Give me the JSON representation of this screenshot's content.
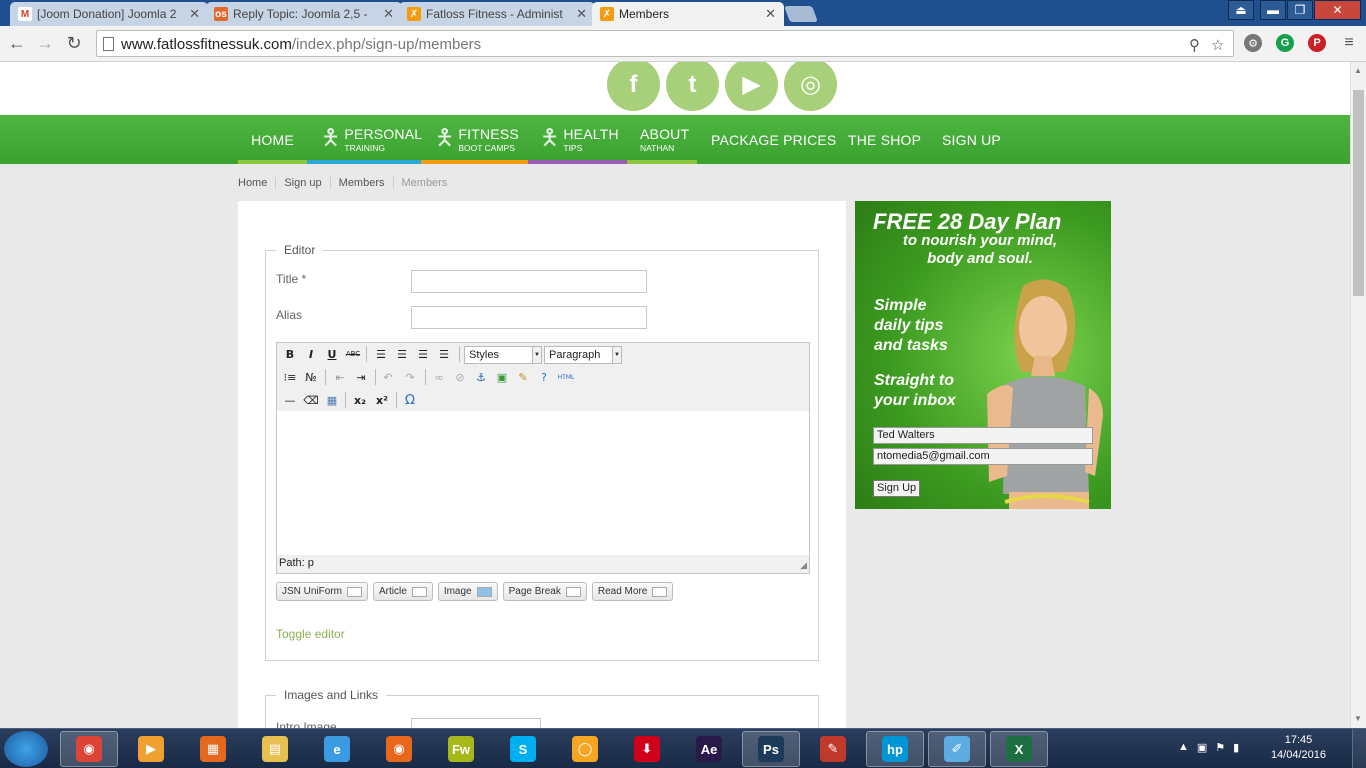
{
  "browser": {
    "tabs": [
      {
        "title": "[Joom Donation] Joomla 2",
        "fav": "M",
        "fav_color": "#d23f31"
      },
      {
        "title": "Reply Topic: Joomla 2,5 -",
        "fav": "os",
        "fav_color": "#e06a2c"
      },
      {
        "title": "Fatloss Fitness - Administ",
        "fav": "✗",
        "fav_color": "#f39c12"
      },
      {
        "title": "Members",
        "fav": "✗",
        "fav_color": "#f39c12"
      }
    ],
    "url_host": "www.fatlossfitnessuk.com",
    "url_path": "/index.php/sign-up/members",
    "window_controls": {
      "minimize": "▬",
      "maximize": "❐",
      "close": "✕"
    }
  },
  "site": {
    "social": [
      "f",
      "t",
      "▶",
      "◎"
    ],
    "nav": [
      {
        "label": "HOME",
        "sub": "",
        "color": "#8dc63f"
      },
      {
        "label": "PERSONAL",
        "sub": "TRAINING",
        "color": "#2aa8d8"
      },
      {
        "label": "FITNESS",
        "sub": "BOOT CAMPS",
        "color": "#f39c12"
      },
      {
        "label": "HEALTH",
        "sub": "TIPS",
        "color": "#9b59b6"
      },
      {
        "label": "ABOUT",
        "sub": "NATHAN",
        "color": "#8dc63f"
      },
      {
        "label": "PACKAGE PRICES",
        "sub": "",
        "color": ""
      },
      {
        "label": "THE SHOP",
        "sub": "",
        "color": ""
      },
      {
        "label": "SIGN UP",
        "sub": "",
        "color": ""
      }
    ],
    "breadcrumb": [
      "Home",
      "Sign up",
      "Members",
      "Members"
    ]
  },
  "form": {
    "editor_legend": "Editor",
    "title_label": "Title *",
    "title_value": "",
    "alias_label": "Alias",
    "alias_value": "",
    "styles_select": "Styles",
    "paragraph_select": "Paragraph",
    "path_text": "Path: p",
    "editor_buttons": [
      "JSN UniForm",
      "Article",
      "Image",
      "Page Break",
      "Read More"
    ],
    "toggle_editor": "Toggle editor",
    "images_legend": "Images and Links",
    "intro_image_label": "Intro Image"
  },
  "ad": {
    "headline": "FREE 28 Day Plan",
    "sub1": "to nourish your mind,",
    "sub2": "body and soul.",
    "tag1a": "Simple",
    "tag1b": "daily tips",
    "tag1c": "and tasks",
    "tag2a": "Straight to",
    "tag2b": "your inbox",
    "name_value": "Ted Walters",
    "email_value": "ntomedia5@gmail.com",
    "signup_button": "Sign Up"
  },
  "taskbar": {
    "apps": [
      {
        "name": "chrome",
        "glyph": "◉",
        "color": "#db4437",
        "active": true
      },
      {
        "name": "media",
        "glyph": "▶",
        "color": "#f0a030",
        "active": false
      },
      {
        "name": "office",
        "glyph": "▦",
        "color": "#e5681e",
        "active": false
      },
      {
        "name": "explorer",
        "glyph": "▤",
        "color": "#e8c050",
        "active": false
      },
      {
        "name": "ie",
        "glyph": "e",
        "color": "#3b9ae1",
        "active": false
      },
      {
        "name": "firefox",
        "glyph": "◉",
        "color": "#e8671c",
        "active": false
      },
      {
        "name": "fireworks",
        "glyph": "Fw",
        "color": "#a6b81b",
        "active": false
      },
      {
        "name": "skype",
        "glyph": "S",
        "color": "#00aff0",
        "active": false
      },
      {
        "name": "circle-app",
        "glyph": "◯",
        "color": "#f5a623",
        "active": false
      },
      {
        "name": "downloader",
        "glyph": "⬇",
        "color": "#d0021b",
        "active": false
      },
      {
        "name": "aftereffects",
        "glyph": "Ae",
        "color": "#2a1a4a",
        "active": false
      },
      {
        "name": "photoshop",
        "glyph": "Ps",
        "color": "#1c3b5a",
        "active": true
      },
      {
        "name": "tool",
        "glyph": "✎",
        "color": "#c0392b",
        "active": false
      },
      {
        "name": "hp",
        "glyph": "hp",
        "color": "#0096d6",
        "active": true
      },
      {
        "name": "notes",
        "glyph": "✐",
        "color": "#5dade2",
        "active": true
      },
      {
        "name": "excel",
        "glyph": "X",
        "color": "#1d6f42",
        "active": true
      }
    ],
    "time": "17:45",
    "date": "14/04/2016"
  }
}
